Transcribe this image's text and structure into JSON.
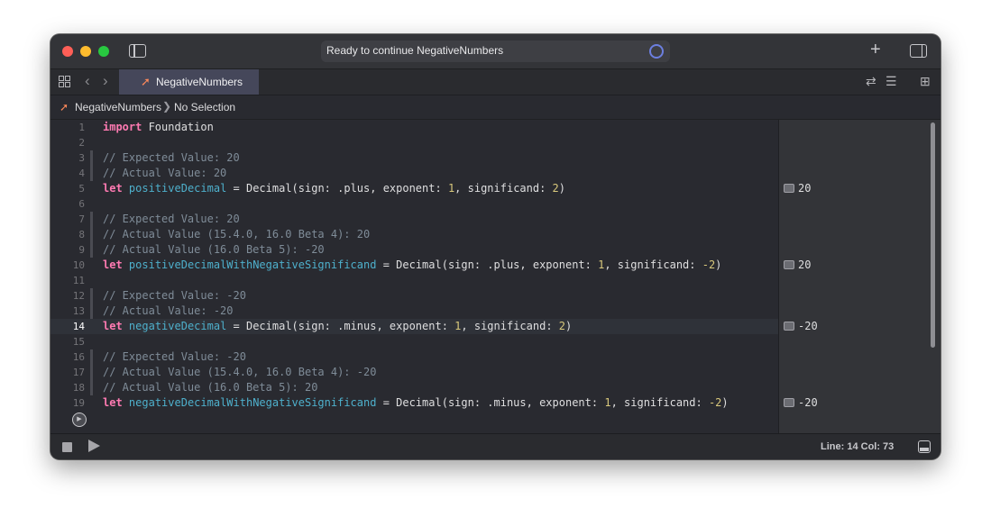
{
  "window": {
    "status_text": "Ready to continue NegativeNumbers"
  },
  "tab": {
    "label": "NegativeNumbers"
  },
  "breadcrumb": {
    "file": "NegativeNumbers",
    "separator": "❯",
    "selection": "No Selection"
  },
  "editor": {
    "current_line": 14,
    "lines": [
      "1",
      "2",
      "3",
      "4",
      "5",
      "6",
      "7",
      "8",
      "9",
      "10",
      "11",
      "12",
      "13",
      "14",
      "15",
      "16",
      "17",
      "18",
      "19"
    ],
    "code": {
      "l1": "import",
      "l1b": " Foundation",
      "l3": "// Expected Value: 20",
      "l4": "// Actual Value: 20",
      "l5_kw": "let",
      "l5_id": "positiveDecimal",
      "l5_a": " = Decimal(sign: .plus, exponent: ",
      "l5_n1": "1",
      "l5_b": ", significand: ",
      "l5_n2": "2",
      "l5_c": ")",
      "l7": "// Expected Value: 20",
      "l8": "// Actual Value (15.4.0, 16.0 Beta 4): 20",
      "l9": "// Actual Value (16.0 Beta 5): -20",
      "l10_kw": "let",
      "l10_id": "positiveDecimalWithNegativeSignificand",
      "l10_a": " = Decimal(sign: .plus, exponent: ",
      "l10_n1": "1",
      "l10_b": ", significand: ",
      "l10_n2": "-2",
      "l10_c": ")",
      "l12": "// Expected Value: -20",
      "l13": "// Actual Value: -20",
      "l14_kw": "let",
      "l14_id": "negativeDecimal",
      "l14_a": " = Decimal(sign: .minus, exponent: ",
      "l14_n1": "1",
      "l14_b": ", significand: ",
      "l14_n2": "2",
      "l14_c": ")",
      "l16": "// Expected Value: -20",
      "l17": "// Actual Value (15.4.0, 16.0 Beta 4): -20",
      "l18": "// Actual Value (16.0 Beta 5): 20",
      "l19_kw": "let",
      "l19_id": "negativeDecimalWithNegativeSignificand",
      "l19_a": " = Decimal(sign: .minus, exponent: ",
      "l19_n1": "1",
      "l19_b": ", significand: ",
      "l19_n2": "-2",
      "l19_c": ")"
    }
  },
  "results": {
    "r5": "20",
    "r10": "20",
    "r14": "-20",
    "r19": "-20"
  },
  "debugbar": {
    "line_col": "Line: 14  Col: 73"
  },
  "colors": {
    "keyword": "#ff7ab2",
    "comment": "#7f8c98",
    "number": "#d9c97c",
    "identifier": "#4eb0cc"
  }
}
